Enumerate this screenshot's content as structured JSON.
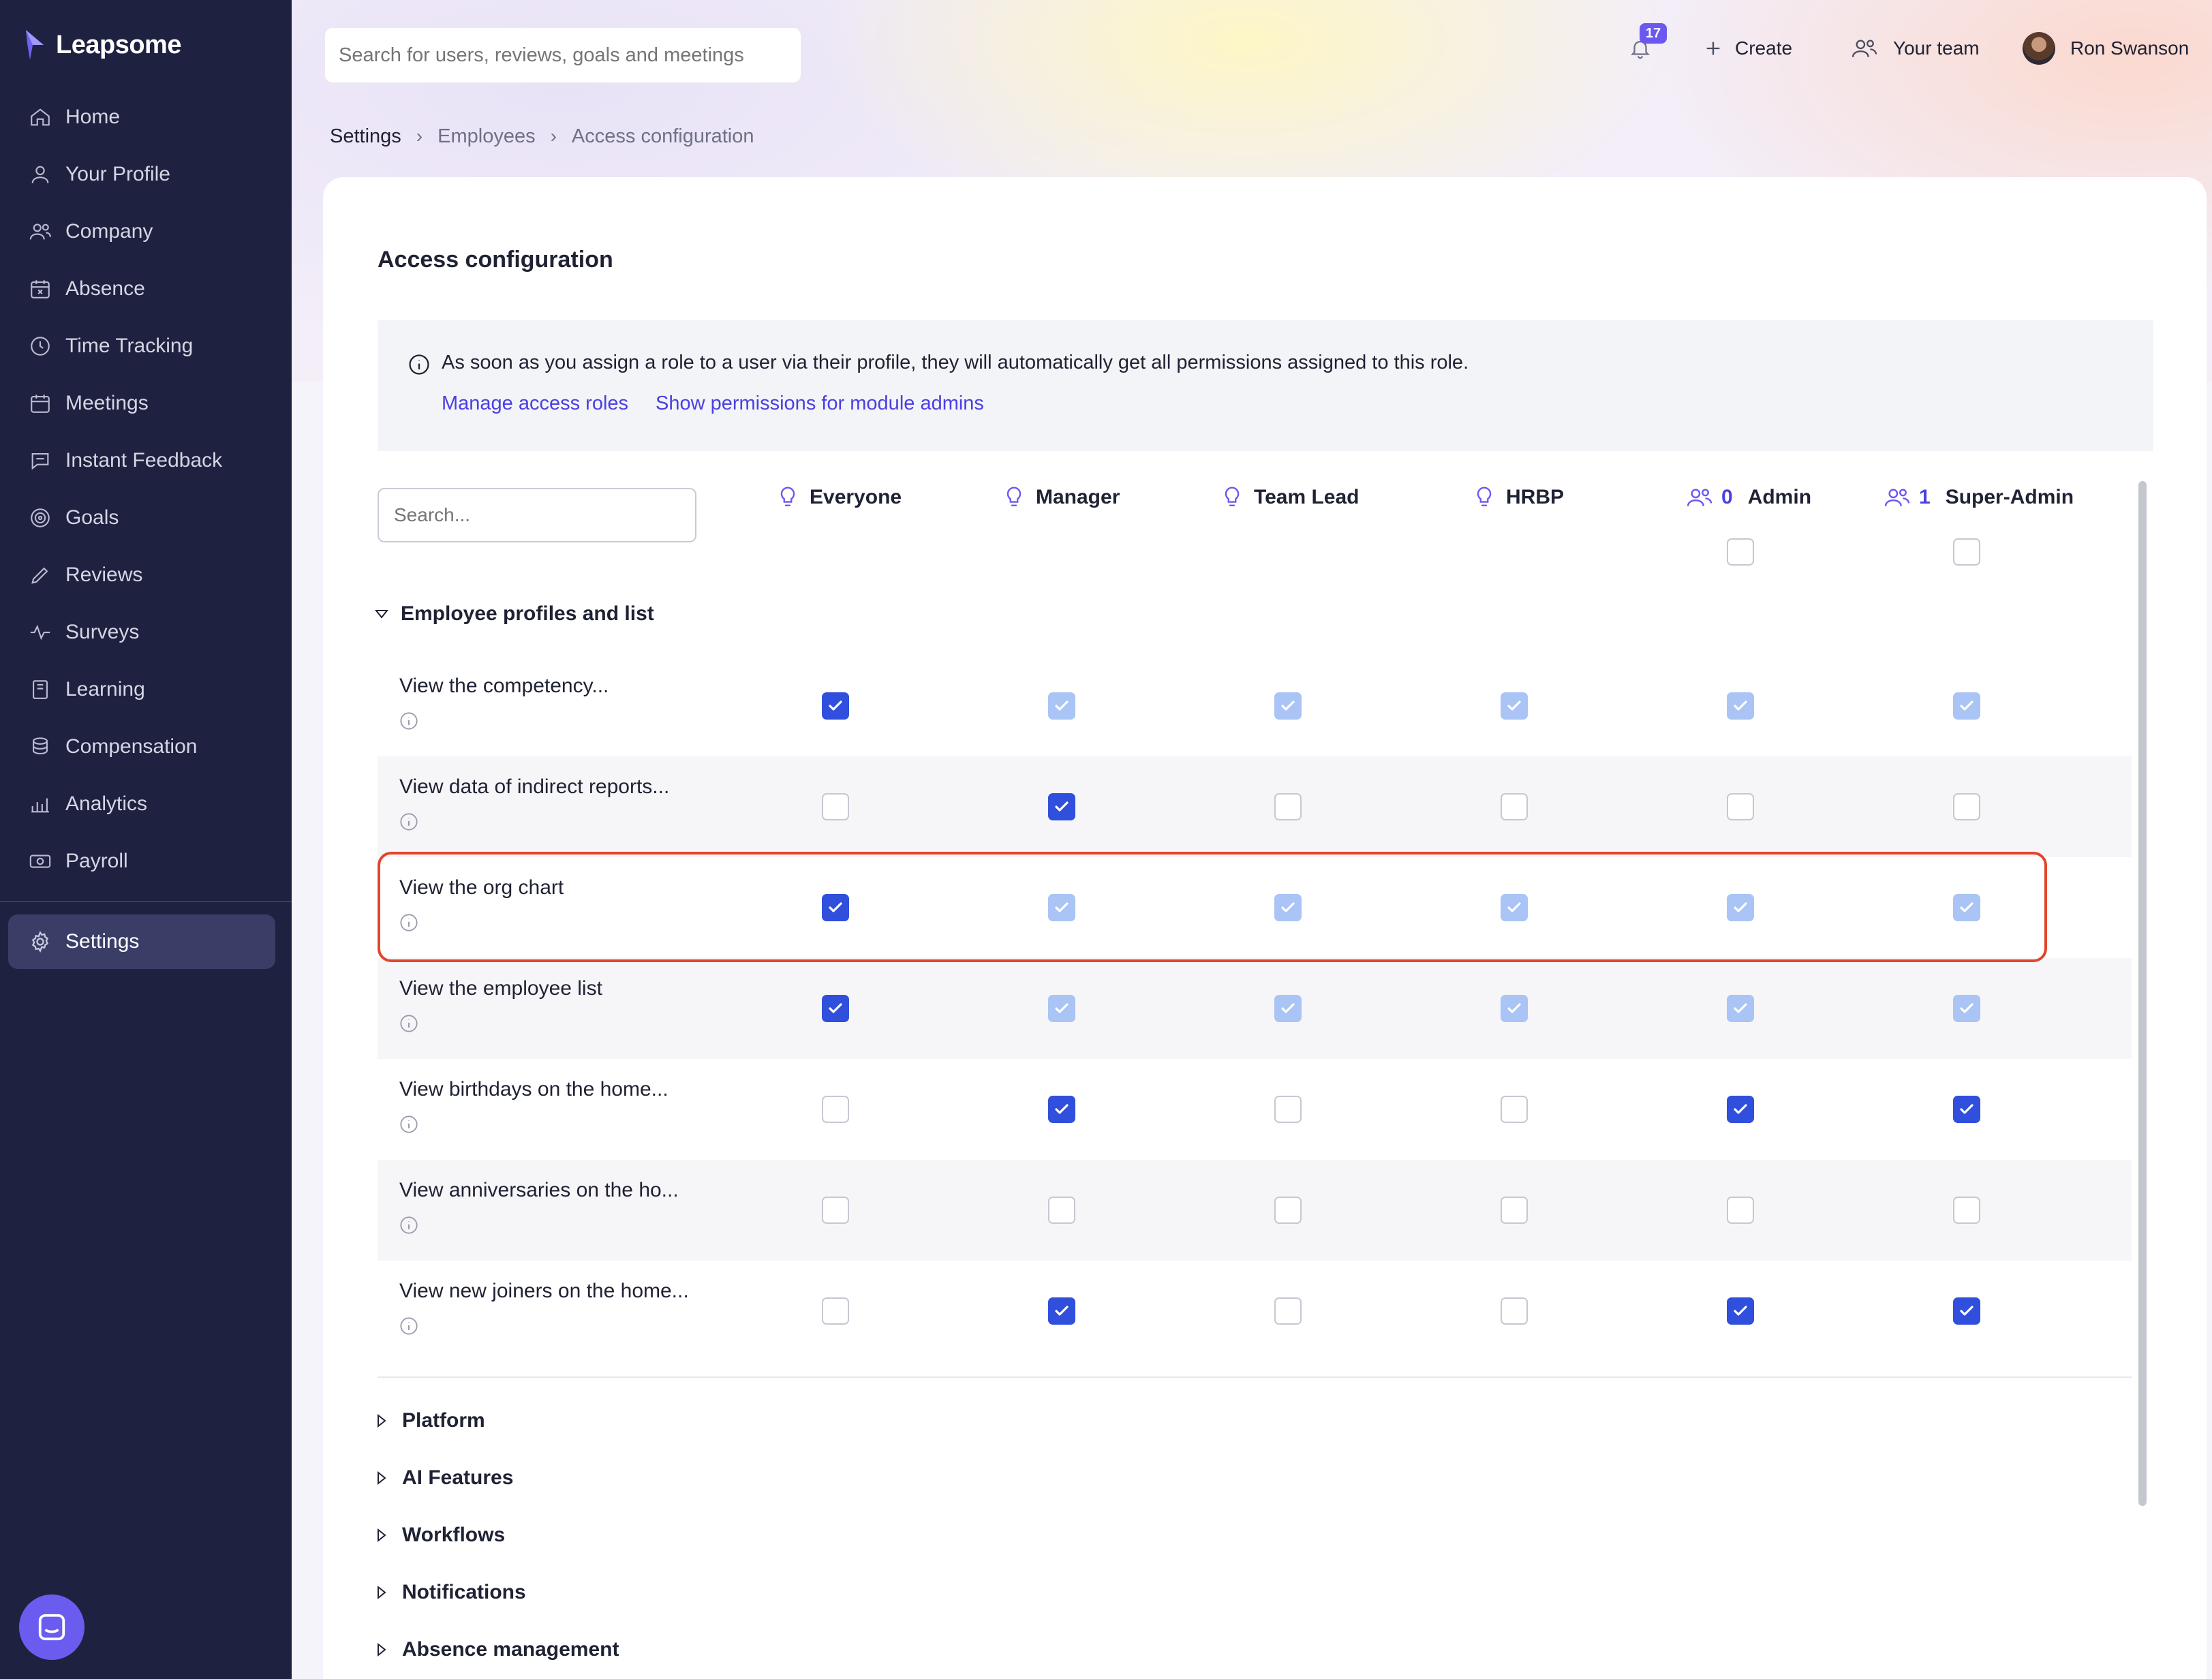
{
  "app": {
    "brand": "Leapsome"
  },
  "sidebar": {
    "items": [
      {
        "label": "Home",
        "icon": "home-icon"
      },
      {
        "label": "Your Profile",
        "icon": "user-icon"
      },
      {
        "label": "Company",
        "icon": "users-icon"
      },
      {
        "label": "Absence",
        "icon": "calendar-x-icon"
      },
      {
        "label": "Time Tracking",
        "icon": "clock-icon"
      },
      {
        "label": "Meetings",
        "icon": "calendar-icon"
      },
      {
        "label": "Instant Feedback",
        "icon": "chat-icon"
      },
      {
        "label": "Goals",
        "icon": "target-icon"
      },
      {
        "label": "Reviews",
        "icon": "pencil-icon"
      },
      {
        "label": "Surveys",
        "icon": "pulse-icon"
      },
      {
        "label": "Learning",
        "icon": "book-icon"
      },
      {
        "label": "Compensation",
        "icon": "coins-icon"
      },
      {
        "label": "Analytics",
        "icon": "chart-icon"
      },
      {
        "label": "Payroll",
        "icon": "banknote-icon"
      }
    ],
    "settings_label": "Settings"
  },
  "header": {
    "search_placeholder": "Search for users, reviews, goals and meetings",
    "notifications_count": "17",
    "create_label": "Create",
    "your_team_label": "Your team",
    "user_name": "Ron Swanson"
  },
  "breadcrumb": [
    "Settings",
    "Employees",
    "Access configuration"
  ],
  "page": {
    "title": "Access configuration",
    "info_text": "As soon as you assign a role to a user via their profile, they will automatically get all permissions assigned to this role.",
    "link_manage_roles": "Manage access roles",
    "link_module_admins": "Show permissions for module admins",
    "search_placeholder": "Search..."
  },
  "roles": [
    {
      "name": "Everyone",
      "icon": "lightbulb-icon"
    },
    {
      "name": "Manager",
      "icon": "lightbulb-icon"
    },
    {
      "name": "Team Lead",
      "icon": "lightbulb-icon"
    },
    {
      "name": "HRBP",
      "icon": "lightbulb-icon"
    },
    {
      "name": "Admin",
      "icon": "users-icon",
      "count": "0"
    },
    {
      "name": "Super-Admin",
      "icon": "users-icon",
      "count": "1"
    }
  ],
  "section": {
    "title": "Employee profiles and list",
    "expanded": true,
    "permissions": [
      {
        "label": "View the competency...",
        "states": [
          "checked",
          "inherit",
          "inherit",
          "inherit",
          "inherit",
          "inherit"
        ]
      },
      {
        "label": "View data of indirect reports...",
        "states": [
          "empty",
          "checked",
          "empty",
          "empty",
          "empty",
          "empty"
        ]
      },
      {
        "label": "View the org chart",
        "states": [
          "checked",
          "inherit",
          "inherit",
          "inherit",
          "inherit",
          "inherit"
        ],
        "highlighted": true
      },
      {
        "label": "View the employee list",
        "states": [
          "checked",
          "inherit",
          "inherit",
          "inherit",
          "inherit",
          "inherit"
        ]
      },
      {
        "label": "View birthdays on the home...",
        "states": [
          "empty",
          "checked",
          "empty",
          "empty",
          "checked",
          "checked"
        ]
      },
      {
        "label": "View anniversaries on the ho...",
        "states": [
          "empty",
          "empty",
          "empty",
          "empty",
          "empty",
          "empty"
        ]
      },
      {
        "label": "View new joiners on the home...",
        "states": [
          "empty",
          "checked",
          "empty",
          "empty",
          "checked",
          "checked"
        ]
      }
    ]
  },
  "collapsed_groups": [
    "Platform",
    "AI Features",
    "Workflows",
    "Notifications",
    "Absence management"
  ],
  "colors": {
    "sidebar_bg": "#1f2140",
    "accent": "#4b3fe0",
    "checkbox_checked": "#2f4fdc",
    "checkbox_inherited": "#a9c4f5",
    "highlight_border": "#e2452b"
  }
}
